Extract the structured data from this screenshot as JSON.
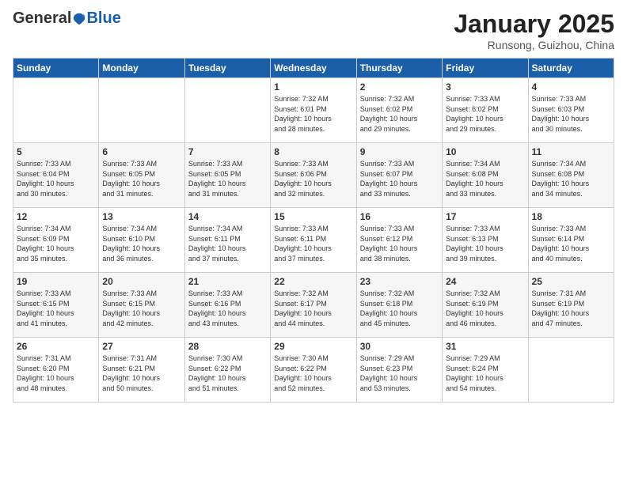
{
  "logo": {
    "general": "General",
    "blue": "Blue"
  },
  "title": "January 2025",
  "subtitle": "Runsong, Guizhou, China",
  "days_of_week": [
    "Sunday",
    "Monday",
    "Tuesday",
    "Wednesday",
    "Thursday",
    "Friday",
    "Saturday"
  ],
  "weeks": [
    [
      {
        "day": "",
        "info": ""
      },
      {
        "day": "",
        "info": ""
      },
      {
        "day": "",
        "info": ""
      },
      {
        "day": "1",
        "info": "Sunrise: 7:32 AM\nSunset: 6:01 PM\nDaylight: 10 hours\nand 28 minutes."
      },
      {
        "day": "2",
        "info": "Sunrise: 7:32 AM\nSunset: 6:02 PM\nDaylight: 10 hours\nand 29 minutes."
      },
      {
        "day": "3",
        "info": "Sunrise: 7:33 AM\nSunset: 6:02 PM\nDaylight: 10 hours\nand 29 minutes."
      },
      {
        "day": "4",
        "info": "Sunrise: 7:33 AM\nSunset: 6:03 PM\nDaylight: 10 hours\nand 30 minutes."
      }
    ],
    [
      {
        "day": "5",
        "info": "Sunrise: 7:33 AM\nSunset: 6:04 PM\nDaylight: 10 hours\nand 30 minutes."
      },
      {
        "day": "6",
        "info": "Sunrise: 7:33 AM\nSunset: 6:05 PM\nDaylight: 10 hours\nand 31 minutes."
      },
      {
        "day": "7",
        "info": "Sunrise: 7:33 AM\nSunset: 6:05 PM\nDaylight: 10 hours\nand 31 minutes."
      },
      {
        "day": "8",
        "info": "Sunrise: 7:33 AM\nSunset: 6:06 PM\nDaylight: 10 hours\nand 32 minutes."
      },
      {
        "day": "9",
        "info": "Sunrise: 7:33 AM\nSunset: 6:07 PM\nDaylight: 10 hours\nand 33 minutes."
      },
      {
        "day": "10",
        "info": "Sunrise: 7:34 AM\nSunset: 6:08 PM\nDaylight: 10 hours\nand 33 minutes."
      },
      {
        "day": "11",
        "info": "Sunrise: 7:34 AM\nSunset: 6:08 PM\nDaylight: 10 hours\nand 34 minutes."
      }
    ],
    [
      {
        "day": "12",
        "info": "Sunrise: 7:34 AM\nSunset: 6:09 PM\nDaylight: 10 hours\nand 35 minutes."
      },
      {
        "day": "13",
        "info": "Sunrise: 7:34 AM\nSunset: 6:10 PM\nDaylight: 10 hours\nand 36 minutes."
      },
      {
        "day": "14",
        "info": "Sunrise: 7:34 AM\nSunset: 6:11 PM\nDaylight: 10 hours\nand 37 minutes."
      },
      {
        "day": "15",
        "info": "Sunrise: 7:33 AM\nSunset: 6:11 PM\nDaylight: 10 hours\nand 37 minutes."
      },
      {
        "day": "16",
        "info": "Sunrise: 7:33 AM\nSunset: 6:12 PM\nDaylight: 10 hours\nand 38 minutes."
      },
      {
        "day": "17",
        "info": "Sunrise: 7:33 AM\nSunset: 6:13 PM\nDaylight: 10 hours\nand 39 minutes."
      },
      {
        "day": "18",
        "info": "Sunrise: 7:33 AM\nSunset: 6:14 PM\nDaylight: 10 hours\nand 40 minutes."
      }
    ],
    [
      {
        "day": "19",
        "info": "Sunrise: 7:33 AM\nSunset: 6:15 PM\nDaylight: 10 hours\nand 41 minutes."
      },
      {
        "day": "20",
        "info": "Sunrise: 7:33 AM\nSunset: 6:15 PM\nDaylight: 10 hours\nand 42 minutes."
      },
      {
        "day": "21",
        "info": "Sunrise: 7:33 AM\nSunset: 6:16 PM\nDaylight: 10 hours\nand 43 minutes."
      },
      {
        "day": "22",
        "info": "Sunrise: 7:32 AM\nSunset: 6:17 PM\nDaylight: 10 hours\nand 44 minutes."
      },
      {
        "day": "23",
        "info": "Sunrise: 7:32 AM\nSunset: 6:18 PM\nDaylight: 10 hours\nand 45 minutes."
      },
      {
        "day": "24",
        "info": "Sunrise: 7:32 AM\nSunset: 6:19 PM\nDaylight: 10 hours\nand 46 minutes."
      },
      {
        "day": "25",
        "info": "Sunrise: 7:31 AM\nSunset: 6:19 PM\nDaylight: 10 hours\nand 47 minutes."
      }
    ],
    [
      {
        "day": "26",
        "info": "Sunrise: 7:31 AM\nSunset: 6:20 PM\nDaylight: 10 hours\nand 48 minutes."
      },
      {
        "day": "27",
        "info": "Sunrise: 7:31 AM\nSunset: 6:21 PM\nDaylight: 10 hours\nand 50 minutes."
      },
      {
        "day": "28",
        "info": "Sunrise: 7:30 AM\nSunset: 6:22 PM\nDaylight: 10 hours\nand 51 minutes."
      },
      {
        "day": "29",
        "info": "Sunrise: 7:30 AM\nSunset: 6:22 PM\nDaylight: 10 hours\nand 52 minutes."
      },
      {
        "day": "30",
        "info": "Sunrise: 7:29 AM\nSunset: 6:23 PM\nDaylight: 10 hours\nand 53 minutes."
      },
      {
        "day": "31",
        "info": "Sunrise: 7:29 AM\nSunset: 6:24 PM\nDaylight: 10 hours\nand 54 minutes."
      },
      {
        "day": "",
        "info": ""
      }
    ]
  ]
}
